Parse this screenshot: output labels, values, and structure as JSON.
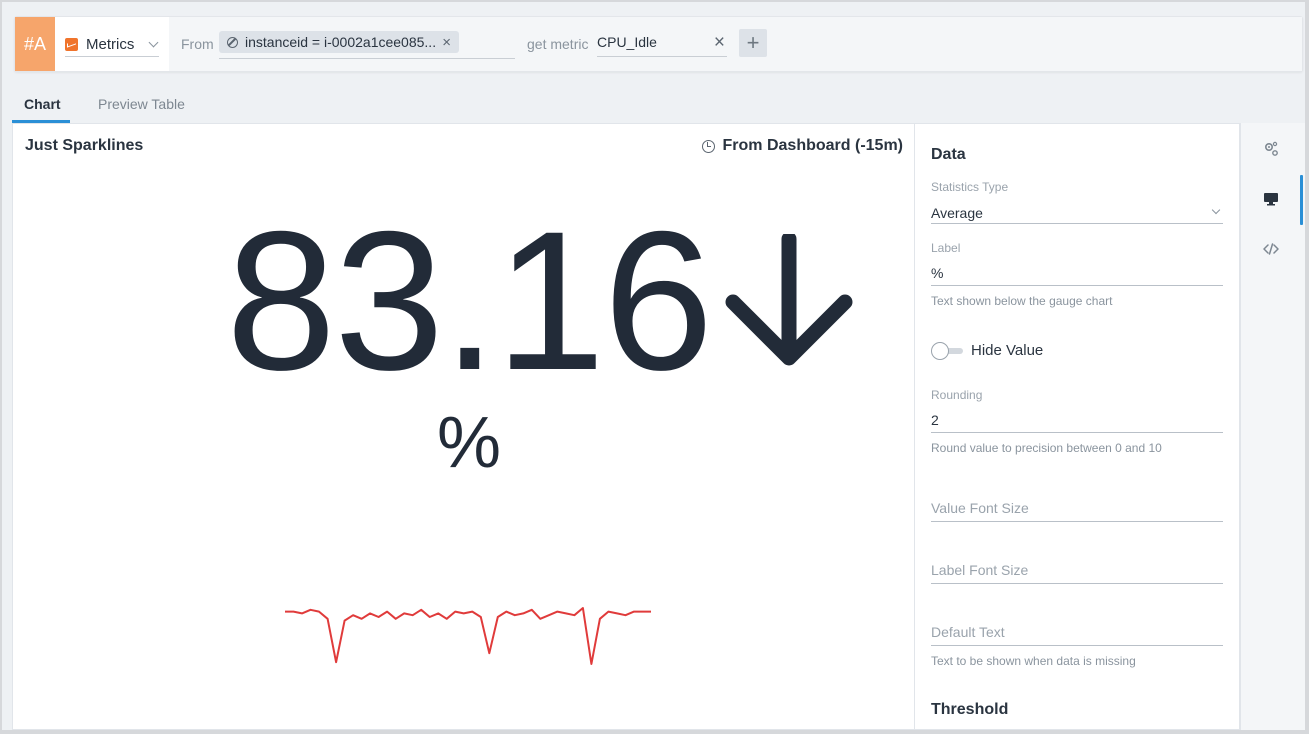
{
  "query": {
    "id": "#A",
    "source_label": "Metrics",
    "from_label": "From",
    "filter_chip": "instanceid = i-0002a1cee085...",
    "get_metric_label": "get metric",
    "metric_value": "CPU_Idle",
    "add_label": "+",
    "remove_label": "×"
  },
  "tabs": {
    "chart": "Chart",
    "preview": "Preview Table"
  },
  "chart": {
    "title": "Just Sparklines",
    "time_range": "From Dashboard (-15m)",
    "value": "83.16",
    "unit_label": "%",
    "trend": "down",
    "sparkline_color": "#e03b3b"
  },
  "chart_data": {
    "type": "line",
    "title": "",
    "series": [
      {
        "values": [
          50,
          50,
          49,
          51,
          50,
          46,
          22,
          45,
          48,
          46,
          49,
          47,
          50,
          46,
          49,
          48,
          51,
          47,
          49,
          46,
          50,
          49,
          50,
          47,
          27,
          47,
          50,
          48,
          49,
          51,
          46,
          48,
          50,
          49,
          48,
          52,
          21,
          46,
          50,
          49,
          48,
          50,
          50,
          50
        ]
      }
    ]
  },
  "settings": {
    "heading": "Data",
    "stat_type_label": "Statistics Type",
    "stat_type_value": "Average",
    "label_label": "Label",
    "label_value": "%",
    "label_help": "Text shown below the gauge chart",
    "hide_value_label": "Hide Value",
    "rounding_label": "Rounding",
    "rounding_value": "2",
    "rounding_help": "Round value to precision between 0 and 10",
    "value_font_size_placeholder": "Value Font Size",
    "label_font_size_placeholder": "Label Font Size",
    "default_text_placeholder": "Default Text",
    "default_text_help": "Text to be shown when data is missing",
    "threshold_heading": "Threshold"
  },
  "rail": {
    "items": [
      "settings-gears-icon",
      "monitor-icon",
      "code-icon"
    ],
    "accent": "#2a8fd6"
  },
  "colors": {
    "query_id_bg": "#f6a56b",
    "value_text": "#222b38",
    "sparkline": "#e03b3b"
  }
}
